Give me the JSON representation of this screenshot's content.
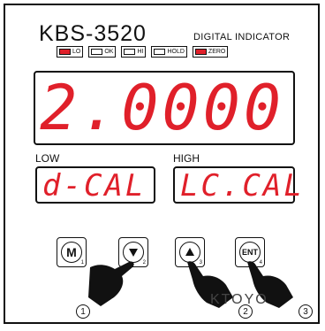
{
  "device": {
    "model": "KBS-3520",
    "subtitle": "DIGITAL INDICATOR",
    "watermark": "KTOYO"
  },
  "leds": [
    {
      "label": "LO",
      "on": true
    },
    {
      "label": "OK",
      "on": false
    },
    {
      "label": "HI",
      "on": false
    },
    {
      "label": "HOLD",
      "on": false
    },
    {
      "label": "ZERO",
      "on": true
    }
  ],
  "display": {
    "main_value": "2.0000",
    "low_label": "LOW",
    "low_value": "d-CAL",
    "high_label": "HIGH",
    "high_value": "LC.CAL"
  },
  "keys": [
    {
      "symbol": "M",
      "index": "1",
      "icon": "mode-key-icon"
    },
    {
      "symbol": "",
      "index": "2",
      "icon": "down-arrow-icon"
    },
    {
      "symbol": "",
      "index": "3",
      "icon": "up-arrow-icon"
    },
    {
      "symbol": "ENT",
      "index": "4",
      "icon": "enter-key-icon"
    }
  ],
  "steps": [
    "1",
    "2",
    "3"
  ],
  "colors": {
    "led_on": "#e0202a",
    "segment": "#e0202a",
    "frame": "#111111"
  }
}
